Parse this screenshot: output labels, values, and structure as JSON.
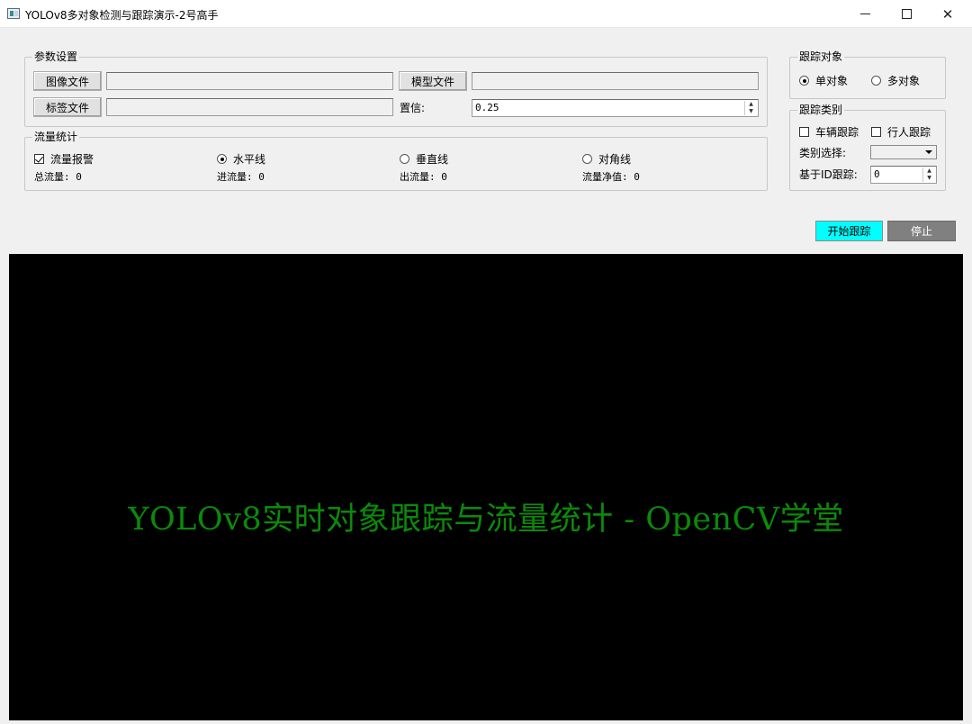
{
  "window": {
    "title": "YOLOv8多对象检测与跟踪演示-2号高手"
  },
  "params": {
    "group_title": "参数设置",
    "image_file_label": "图像文件",
    "image_file_value": "",
    "model_file_label": "模型文件",
    "model_file_value": "",
    "label_file_label": "标签文件",
    "label_file_value": "",
    "confidence_label": "置信:",
    "confidence_value": "0.25"
  },
  "flow": {
    "group_title": "流量统计",
    "alarm_label": "流量报警",
    "alarm_checked": true,
    "line_options": [
      {
        "label": "水平线",
        "checked": true
      },
      {
        "label": "垂直线",
        "checked": false
      },
      {
        "label": "对角线",
        "checked": false
      }
    ],
    "total_label": "总流量: 0",
    "in_label": "进流量: 0",
    "out_label": "出流量: 0",
    "net_label": "流量净值: 0"
  },
  "track_target": {
    "group_title": "跟踪对象",
    "single_label": "单对象",
    "single_checked": true,
    "multi_label": "多对象",
    "multi_checked": false
  },
  "track_category": {
    "group_title": "跟踪类别",
    "vehicle_label": "车辆跟踪",
    "vehicle_checked": false,
    "pedestrian_label": "行人跟踪",
    "pedestrian_checked": false,
    "class_select_label": "类别选择:",
    "class_select_value": "",
    "id_track_label": "基于ID跟踪:",
    "id_track_value": "0"
  },
  "actions": {
    "start_label": "开始跟踪",
    "start_color": "#00ffff",
    "stop_label": "停止",
    "stop_color": "#808080"
  },
  "video": {
    "caption": "YOLOv8实时对象跟踪与流量统计 - OpenCV学堂",
    "caption_color": "#0a8a0a",
    "background": "#000000"
  }
}
